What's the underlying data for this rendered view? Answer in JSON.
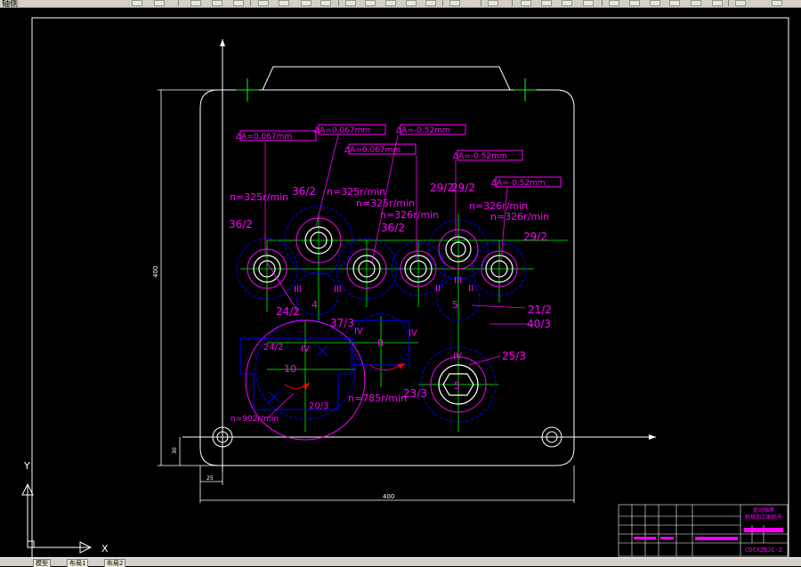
{
  "toolbar": {
    "left_label": "轴侧",
    "icons": [
      "open-icon",
      "save-icon",
      "print-icon",
      "cut-icon",
      "copy-icon",
      "paste-icon",
      "match-icon",
      "undo-icon",
      "redo-icon",
      "zoom-realtime-icon",
      "zoom-window-icon",
      "zoom-previous-icon",
      "properties-icon",
      "design-center-icon",
      "tool-palette-icon",
      "sheet-set-icon",
      "markup-icon",
      "calculator-icon"
    ]
  },
  "drawing": {
    "tolerances": {
      "t1": "ΔA=0.067mm",
      "t2": "ΔA=0.067mm",
      "t3": "ΔA=0.067mm",
      "t4": "ΔA=-0.52mm",
      "t5": "ΔA=-0.52mm",
      "t6": "ΔA=-0.52mm"
    },
    "speeds": {
      "s1": "n=325r/min",
      "s2": "n=325r/min",
      "s3": "n=325r/min",
      "s4": "n=326r/min",
      "s5": "n=326r/min",
      "s6": "n=326r/min",
      "s7": "n=785r/min",
      "s8": "n=902r/min"
    },
    "gear_labels": {
      "g1": "36/2",
      "g2": "36/2",
      "g3": "36/2",
      "g4": "29/2",
      "g5": "29/2",
      "g6": "29/2",
      "g7": "24/2",
      "g8": "37/3",
      "g9": "21/2",
      "g10": "40/3",
      "g11": "25/3",
      "g12": "24/2",
      "g13": "20/3",
      "g14": "23/3"
    },
    "roman": {
      "r1": "III",
      "r2": "III",
      "r3": "II",
      "r4": "III",
      "r5": "II",
      "r6": "IV",
      "r7": "IV",
      "r8": "IV",
      "r9": "IV"
    },
    "numbers": {
      "n4": "4",
      "n5": "5",
      "n0": "0",
      "n10": "10",
      "n5b": "5"
    },
    "dims": {
      "height": "400",
      "width": "400",
      "d30": "30",
      "d25": "25"
    }
  },
  "title_block": {
    "line1": "驱动轴承",
    "line2": "机械加工图纸号",
    "code": "CDCXZBJC-2"
  },
  "ucs": {
    "x_label": "X",
    "y_label": "Y"
  },
  "status": {
    "tab_model": "模型",
    "tab_layout1": "布局1",
    "tab_layout2": "布局2"
  },
  "colors": {
    "magenta": "#ff00ff",
    "green": "#00ff00",
    "blue": "#0000ff",
    "white": "#ffffff",
    "red": "#ff0000"
  }
}
